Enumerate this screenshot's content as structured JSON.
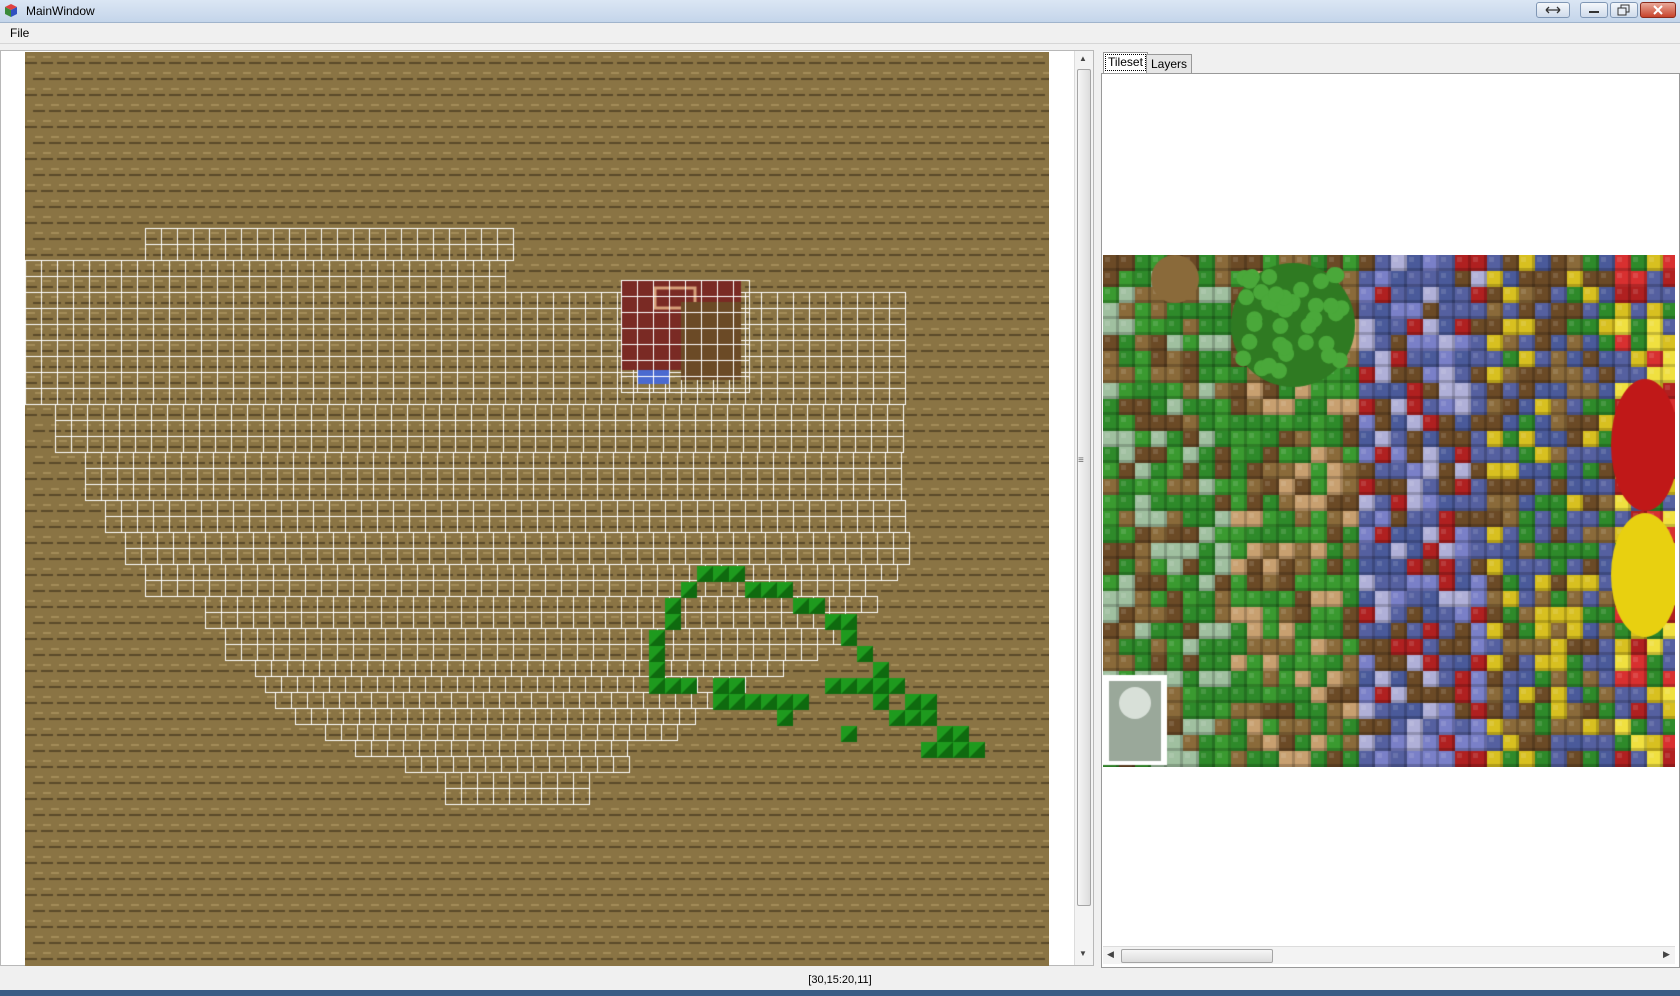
{
  "window": {
    "title": "MainWindow"
  },
  "menu": {
    "file_label": "File"
  },
  "tabs": [
    {
      "label": "Tileset",
      "active": true
    },
    {
      "label": "Layers",
      "active": false
    }
  ],
  "status": {
    "coordinates": "[30,15:20,11]"
  },
  "colors": {
    "dirt_base": "#8a7444",
    "dirt_stripe": "#5a4a2a",
    "grid_line": "#ffffff",
    "grass_tile": "#1e9a1e",
    "house_roof": "#7a2a24",
    "title_bar": "#c4d5ea"
  },
  "icons": {
    "app": "cube-icon",
    "resize": "double-arrow-icon",
    "minimize": "minimize-icon",
    "maximize": "restore-icon",
    "close": "close-icon",
    "splitter_grip": "grip-icon"
  }
}
